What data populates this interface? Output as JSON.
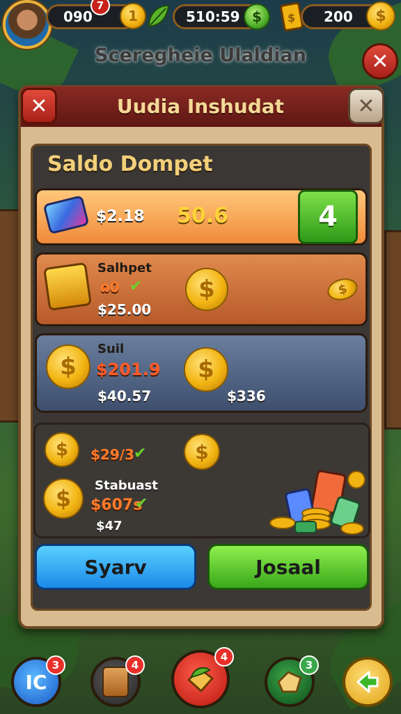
{
  "top_bar": {
    "level_value": "090",
    "level_badge": "7",
    "energy_value": "510:59",
    "gems_value": "200"
  },
  "screen_subtitle": "Sceregheie Ulaldian",
  "panel": {
    "title": "Uudia Inshudat",
    "section_title": "Saldo Dompet",
    "balance": {
      "amount": "$2.18",
      "value": "50.6",
      "plus_label": "4"
    },
    "item1": {
      "name": "Salhpet",
      "sub": "ɷ0",
      "price": "$25.00"
    },
    "item2": {
      "name": "Suil",
      "sub": "$201.9",
      "price": "$40.57",
      "side": "$336"
    },
    "item3": {
      "top": "$29/3",
      "name": "Stabuast",
      "sub": "$607s",
      "price": "$47"
    },
    "buttons": {
      "left": "Syarv",
      "right": "Josaal"
    }
  },
  "nav": {
    "b1": {
      "label": "IC",
      "badge": "3"
    },
    "b2": {
      "badge": "4"
    },
    "b3": {
      "badge": "4"
    },
    "b4": {
      "badge": "3"
    }
  },
  "colors": {
    "accent_red": "#8a2a24",
    "gold": "#f2b412",
    "green": "#3aa81a",
    "blue": "#1a8ae8"
  },
  "icons": [
    "avatar",
    "dollar-coin-icon",
    "leaf-icon",
    "green-dollar-icon",
    "gem-card-icon",
    "close-icon",
    "card-icon",
    "chest-icon",
    "coin-stack-icon",
    "treasure-icon",
    "back-arrow-icon"
  ]
}
